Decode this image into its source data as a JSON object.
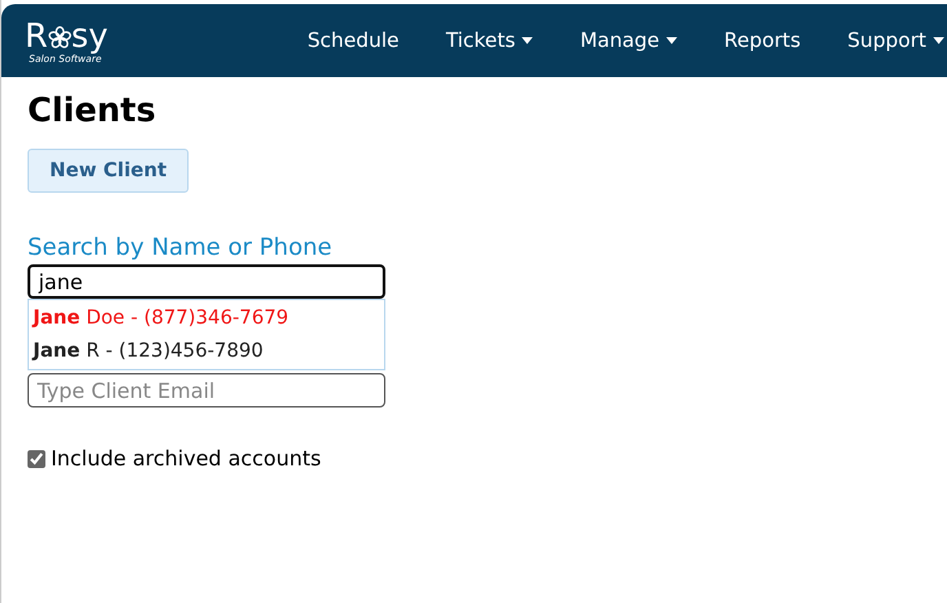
{
  "logo": {
    "name_start": "R",
    "name_end": "sy",
    "tagline": "Salon Software"
  },
  "nav": [
    {
      "label": "Schedule",
      "has_menu": false
    },
    {
      "label": "Tickets",
      "has_menu": true
    },
    {
      "label": "Manage",
      "has_menu": true
    },
    {
      "label": "Reports",
      "has_menu": false
    },
    {
      "label": "Support",
      "has_menu": true
    }
  ],
  "page_title": "Clients",
  "new_client_button": "New Client",
  "search": {
    "label": "Search by Name or Phone",
    "value": "jane"
  },
  "suggestions": [
    {
      "text": "**Jane** Doe - (877)346-7679",
      "selected": true
    },
    {
      "text": "**Jane** R - (123)456-7890",
      "selected": false
    }
  ],
  "email": {
    "placeholder": "Type Client Email"
  },
  "archived": {
    "label": "Include archived accounts",
    "checked": true
  }
}
